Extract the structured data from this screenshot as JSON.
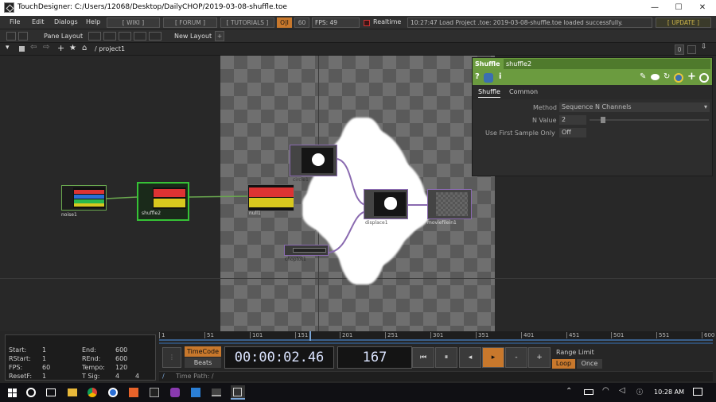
{
  "window": {
    "title": "TouchDesigner: C:/Users/12068/Desktop/DailyCHOP/2019-03-08-shuffle.toe",
    "minimize": "—",
    "maximize": "☐",
    "close": "✕"
  },
  "menu": {
    "items": [
      "File",
      "Edit",
      "Dialogs",
      "Help"
    ],
    "wiki": "[ WIKI ]",
    "forum": "[ FORUM ]",
    "tutorials": "[ TUTORIALS ]",
    "oi": "O|I",
    "sixty": "60",
    "fps": "FPS:  49",
    "realtime": "Realtime",
    "status": "10:27:47 Load Project .toe: 2019-03-08-shuffle.toe loaded successfully.",
    "update": "[ UPDATE ]"
  },
  "panebar": {
    "pane_layout": "Pane Layout",
    "new_layout": "New Layout",
    "plus": "+"
  },
  "pathbar": {
    "path": "/ project1",
    "zero": "0"
  },
  "nodes": {
    "noise": "noise1",
    "shuffle": "shuffle2",
    "null": "null1",
    "circle": "circle1",
    "displace": "displace1",
    "moviefilein": "moviefilein1",
    "choptop": "choptot1"
  },
  "params": {
    "op_type": "Shuffle",
    "op_name": "shuffle2",
    "tabs": [
      "Shuffle",
      "Common"
    ],
    "method_label": "Method",
    "method_value": "Sequence N Channels",
    "nvalue_label": "N Value",
    "nvalue_value": "2",
    "nvalue_slider": 0.1,
    "first_sample_label": "Use First Sample Only",
    "first_sample_value": "Off"
  },
  "timeline": {
    "info": {
      "start_label": "Start:",
      "start": "1",
      "end_label": "End:",
      "end": "600",
      "rstart_label": "RStart:",
      "rstart": "1",
      "rend_label": "REnd:",
      "rend": "600",
      "fps_label": "FPS:",
      "fps": "60",
      "tempo_label": "Tempo:",
      "tempo": "120",
      "resetf_label": "ResetF:",
      "resetf": "1",
      "tsig_label": "T Sig:",
      "tsig_a": "4",
      "tsig_b": "4"
    },
    "ruler": [
      "1",
      "51",
      "101",
      "151",
      "201",
      "251",
      "301",
      "351",
      "401",
      "451",
      "501",
      "551",
      "600"
    ],
    "playhead": 167,
    "timecode_label": "TimeCode",
    "beats_label": "Beats",
    "timecode": "00:00:02.46",
    "frame": "167",
    "range_limit": "Range Limit",
    "loop": "Loop",
    "once": "Once",
    "timepath": "Time Path: /",
    "slash": "/"
  },
  "taskbar": {
    "time": "10:28 AM"
  },
  "colors": {
    "accent_orange": "#c8782c",
    "green_panel": "#6b9b3f",
    "selected_green": "#36c236"
  }
}
